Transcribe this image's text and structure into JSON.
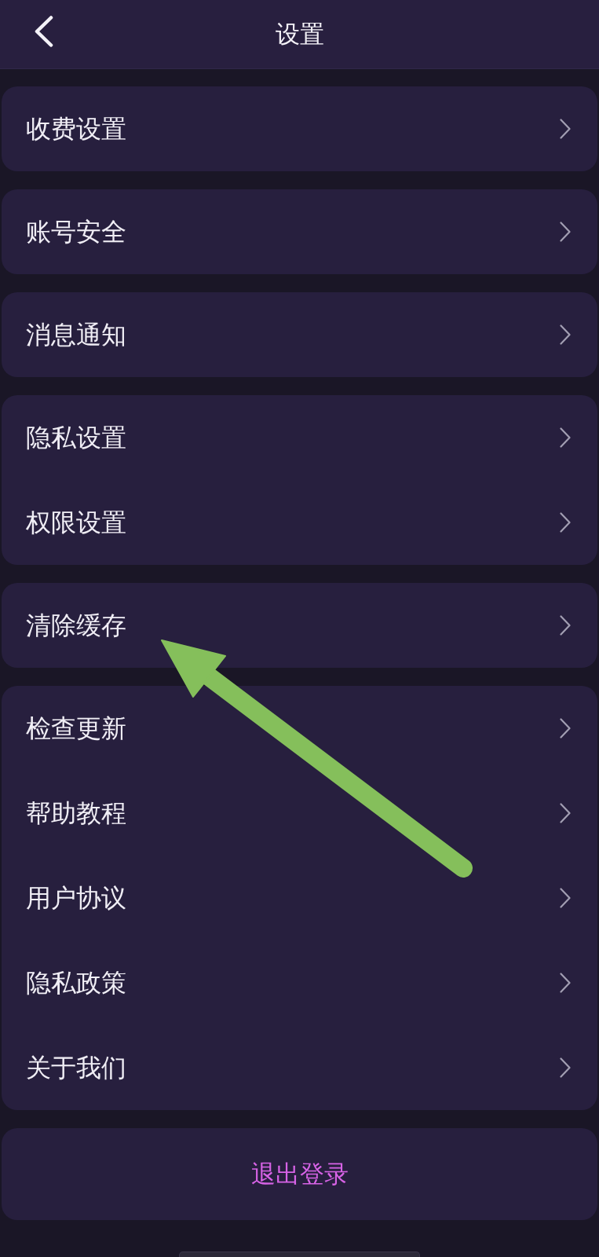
{
  "header": {
    "title": "设置"
  },
  "groups": [
    {
      "items": [
        {
          "label": "收费设置"
        }
      ]
    },
    {
      "items": [
        {
          "label": "账号安全"
        }
      ]
    },
    {
      "items": [
        {
          "label": "消息通知"
        }
      ]
    },
    {
      "items": [
        {
          "label": "隐私设置"
        },
        {
          "label": "权限设置"
        }
      ]
    },
    {
      "items": [
        {
          "label": "清除缓存"
        }
      ]
    },
    {
      "items": [
        {
          "label": "检查更新"
        },
        {
          "label": "帮助教程"
        },
        {
          "label": "用户协议"
        },
        {
          "label": "隐私政策"
        },
        {
          "label": "关于我们"
        }
      ]
    }
  ],
  "logout_button": {
    "label": "退出登录"
  }
}
